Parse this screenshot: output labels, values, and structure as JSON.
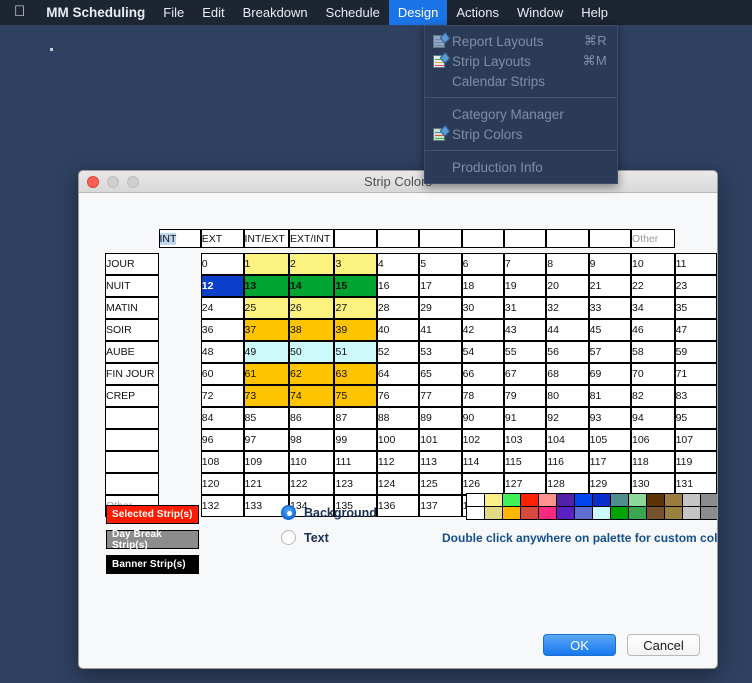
{
  "menubar": {
    "apple_icon": "apple-logo",
    "items": [
      {
        "label": "MM Scheduling",
        "active": false,
        "bold": true
      },
      {
        "label": "File",
        "active": false
      },
      {
        "label": "Edit",
        "active": false
      },
      {
        "label": "Breakdown",
        "active": false
      },
      {
        "label": "Schedule",
        "active": false
      },
      {
        "label": "Design",
        "active": true
      },
      {
        "label": "Actions",
        "active": false
      },
      {
        "label": "Window",
        "active": false
      },
      {
        "label": "Help",
        "active": false
      }
    ]
  },
  "dropdown": {
    "items": [
      {
        "label": "Report Layouts",
        "shortcut": "⌘R",
        "icon": "report-layouts-icon"
      },
      {
        "label": "Strip Layouts",
        "shortcut": "⌘M",
        "icon": "strip-layouts-icon"
      },
      {
        "label": "Calendar Strips",
        "shortcut": "",
        "icon": ""
      },
      {
        "separator": true
      },
      {
        "label": "Category Manager",
        "shortcut": "",
        "icon": ""
      },
      {
        "label": "Strip Colors",
        "shortcut": "",
        "icon": "strip-colors-icon"
      },
      {
        "separator": true
      },
      {
        "label": "Production Info",
        "shortcut": "",
        "icon": ""
      }
    ]
  },
  "dialog": {
    "title": "Strip Colors",
    "column_headers": [
      "INT",
      "EXT",
      "INT/EXT",
      "EXT/INT",
      "",
      "",
      "",
      "",
      "",
      "",
      "",
      "Other"
    ],
    "column_header_selected_index": 0,
    "column_header_dim_index": 11,
    "row_headers": [
      "JOUR",
      "NUIT",
      "MATIN",
      "SOIR",
      "AUBE",
      "FIN JOUR",
      "CREP",
      "",
      "",
      "",
      "",
      "Other"
    ],
    "row_header_dim_index": 11,
    "grid": {
      "rows": 12,
      "cols": 12,
      "first_value": 0,
      "selected_cell": 12,
      "colors": {
        "white": "#ffffff",
        "yellow": "#fbf27f",
        "green": "#00a431",
        "orange": "#ffc400",
        "cyan": "#ccfafa",
        "gray": "#c9c9c9",
        "blue": "#0c3fc9"
      },
      "cell_colors": {
        "1": "yellow",
        "2": "yellow",
        "3": "yellow",
        "12": "blue",
        "13": "green",
        "14": "green",
        "15": "green",
        "25": "yellow",
        "26": "yellow",
        "27": "yellow",
        "37": "orange",
        "38": "orange",
        "39": "orange",
        "49": "cyan",
        "50": "cyan",
        "51": "cyan",
        "61": "orange",
        "62": "orange",
        "63": "orange",
        "73": "orange",
        "74": "orange",
        "75": "orange",
        "143": "gray"
      },
      "bold_cells": [
        12,
        13,
        14,
        15
      ]
    },
    "legend_buttons": [
      {
        "label": "Selected Strip(s)",
        "bg": "#ff1a00",
        "fg": "#ffffff"
      },
      {
        "label": "Day Break Strip(s)",
        "bg": "#8c8c8c",
        "fg": "#ffffff"
      },
      {
        "label": "Banner Strip(s)",
        "bg": "#000000",
        "fg": "#ffffff"
      }
    ],
    "radios": [
      {
        "label": "Background",
        "selected": true
      },
      {
        "label": "Text",
        "selected": false
      }
    ],
    "palette": {
      "row1": [
        "#ffffff",
        "#faf087",
        "#3ef255",
        "#fc2200",
        "#fc938e",
        "#5420aa",
        "#0044ee",
        "#0a2ecc",
        "#4d8f8f",
        "#8ed79a",
        "#5c3305",
        "#9c7c3e",
        "#c5c5c5",
        "#8c8c8c",
        "#474747",
        "#000000"
      ],
      "row2": [
        "#ffffff",
        "#e0db82",
        "#ffb700",
        "#d8493d",
        "#f62a80",
        "#5a22c4",
        "#5e6fd1",
        "#ccfafa",
        "#00a400",
        "#3ba550",
        "#75522c",
        "#9b813f",
        "#c5c5c5",
        "#8c8c8c",
        "#1f1f1f",
        "#000000"
      ],
      "note": "Double click anywhere on palette for custom colors"
    },
    "footer": {
      "ok_label": "OK",
      "cancel_label": "Cancel"
    }
  }
}
